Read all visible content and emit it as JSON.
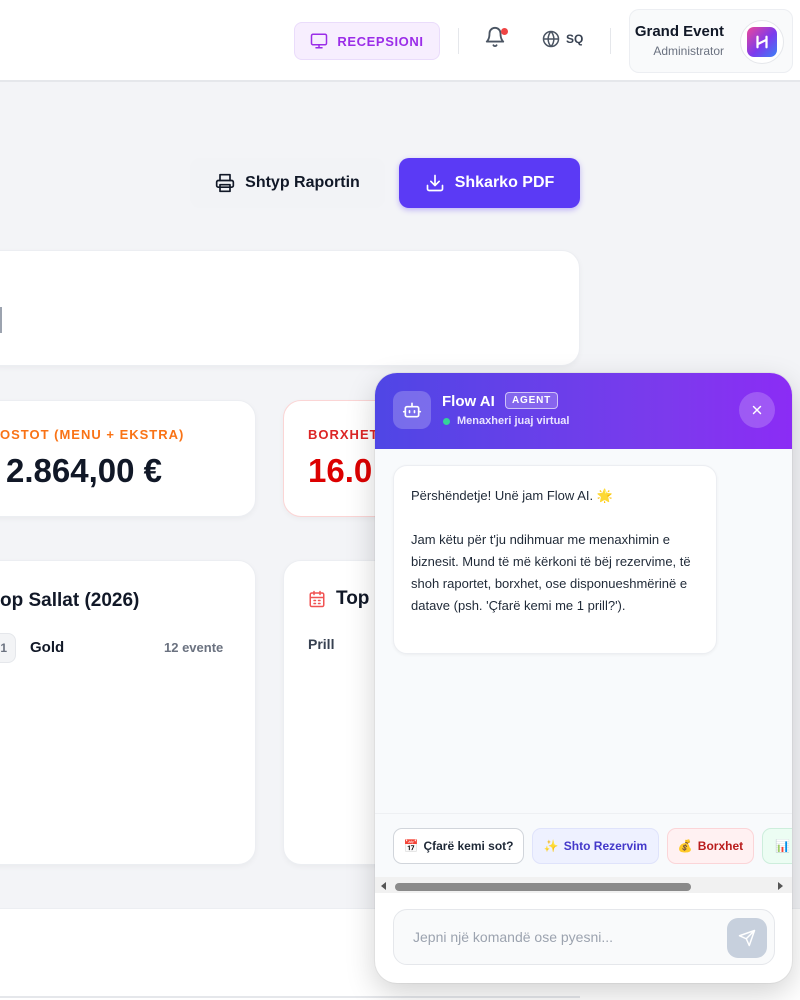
{
  "header": {
    "reception_label": "RECEPSIONI",
    "language": "SQ",
    "user": {
      "name": "Grand Event",
      "role": "Administrator"
    }
  },
  "actions": {
    "print_label": "Shtyp Raportin",
    "pdf_label": "Shkarko PDF"
  },
  "stats": {
    "cost": {
      "label": "OSTOT (MENU + EKSTRA)",
      "value": "2.864,00 €"
    },
    "debt": {
      "label": "BORXHET",
      "value": "16.0"
    }
  },
  "top_halls": {
    "title": "op Sallat (2026)",
    "items": [
      {
        "rank": "1",
        "name": "Gold",
        "count": "12 evente"
      }
    ]
  },
  "top_months": {
    "title": "Top S",
    "items": [
      {
        "name": "Prill"
      }
    ]
  },
  "chat": {
    "title": "Flow AI",
    "tag": "AGENT",
    "subtitle": "Menaxheri juaj virtual",
    "message_line1": "Përshëndetje! Unë jam Flow AI. 🌟",
    "message_line2": "Jam këtu për t'ju ndihmuar me menaxhimin e biznesit. Mund të më kërkoni të bëj rezervime, të shoh raportet, borxhet, ose disponueshmërinë e datave (psh. 'Çfarë kemi me 1 prill?').",
    "chips": [
      {
        "emoji": "📅",
        "label": "Çfarë kemi sot?"
      },
      {
        "emoji": "✨",
        "label": "Shto Rezervim"
      },
      {
        "emoji": "💰",
        "label": "Borxhet"
      },
      {
        "emoji": "📊",
        "label": ""
      }
    ],
    "input_placeholder": "Jepni një komandë ose pyesni..."
  },
  "colors": {
    "accent": "#5b3af5",
    "reception": "#9b2de8",
    "cost_label": "#f97316",
    "debt": "#dc0000"
  }
}
